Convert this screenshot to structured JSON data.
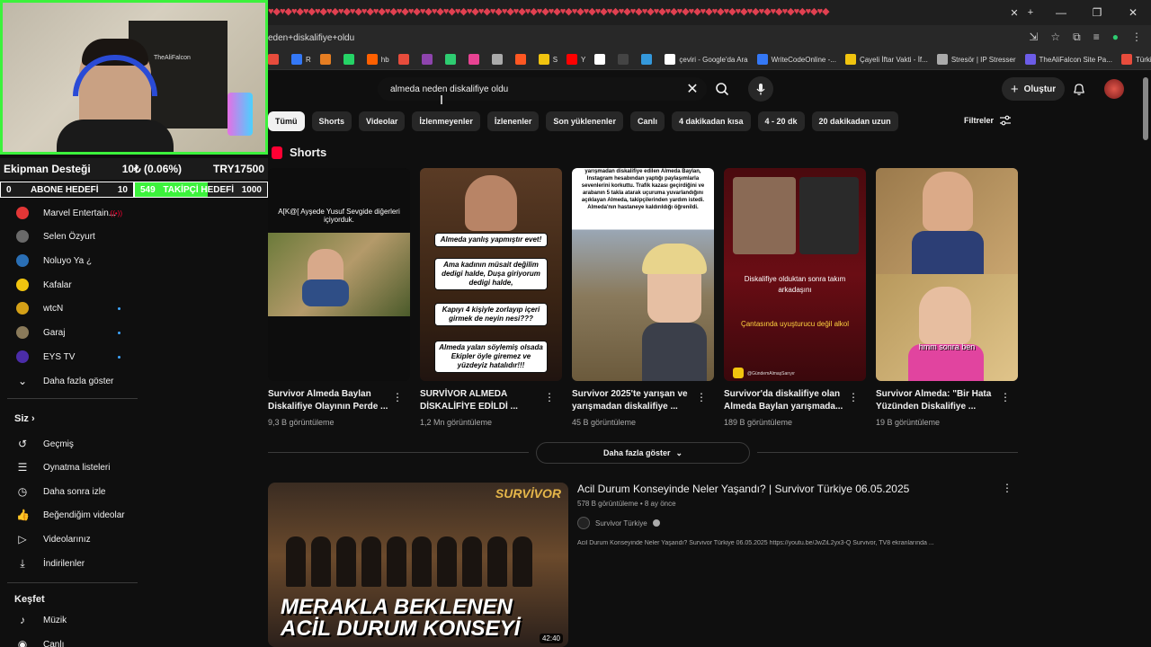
{
  "browser": {
    "url": "eden+diskalifiye+oldu",
    "bookmarks": [
      {
        "label": "",
        "color": "#e74c3c"
      },
      {
        "label": "R",
        "color": "#3478f6"
      },
      {
        "label": "",
        "color": "#e67e22"
      },
      {
        "label": "",
        "color": "#25d366"
      },
      {
        "label": "hb",
        "color": "#ff6000"
      },
      {
        "label": "",
        "color": "#e74c3c"
      },
      {
        "label": "",
        "color": "#8e44ad"
      },
      {
        "label": "",
        "color": "#2ecc71"
      },
      {
        "label": "",
        "color": "#e84393"
      },
      {
        "label": "",
        "color": "#aaa"
      },
      {
        "label": "",
        "color": "#ff5722"
      },
      {
        "label": "S",
        "color": "#f1c40f"
      },
      {
        "label": "Y",
        "color": "#ff0000"
      },
      {
        "label": "",
        "color": "#fff"
      },
      {
        "label": "",
        "color": "#444"
      },
      {
        "label": "",
        "color": "#3498db"
      },
      {
        "label": "çeviri - Google'da Ara",
        "color": "#fff"
      },
      {
        "label": "WriteCodeOnline -...",
        "color": "#3478f6"
      },
      {
        "label": "Çayeli İftar Vakti - İf...",
        "color": "#f1c40f"
      },
      {
        "label": "Stresör | IP Stresser",
        "color": "#aaa"
      },
      {
        "label": "TheAliFalcon Site Pa...",
        "color": "#6c5ce7"
      },
      {
        "label": "Türkiye'nin En Renkl...",
        "color": "#e74c3c"
      }
    ]
  },
  "overlay": {
    "cam_logo": "TheAliFalcon",
    "donation_label": "Ekipman Desteği",
    "donation_amount": "10₺ (0.06%)",
    "donation_goal": "TRY17500",
    "sub_current": "0",
    "sub_label": "ABONE HEDEFİ",
    "sub_target": "10",
    "follow_current": "549",
    "follow_label": "TAKİPÇİ HEDEFİ",
    "follow_target": "1000",
    "follow_progress": 0.549,
    "accent": "#3cf23c"
  },
  "sidebar": {
    "subscriptions": [
      {
        "name": "Marvel Entertain...",
        "color": "#e23636",
        "live": true,
        "dot": false
      },
      {
        "name": "Selen Özyurt",
        "color": "#6a6a6a",
        "live": false,
        "dot": false
      },
      {
        "name": "Noluyo Ya ¿",
        "color": "#2a6fb5",
        "live": false,
        "dot": false
      },
      {
        "name": "Kafalar",
        "color": "#f1c40f",
        "live": false,
        "dot": false
      },
      {
        "name": "wtcN",
        "color": "#d4a017",
        "live": false,
        "dot": true
      },
      {
        "name": "Garaj",
        "color": "#8a7a5a",
        "live": false,
        "dot": true
      },
      {
        "name": "EYS TV",
        "color": "#4b2ca8",
        "live": false,
        "dot": true
      }
    ],
    "show_more": "Daha fazla göster",
    "you_heading": "Siz",
    "you_items": [
      {
        "label": "Geçmiş",
        "icon": "history-icon"
      },
      {
        "label": "Oynatma listeleri",
        "icon": "playlist-icon"
      },
      {
        "label": "Daha sonra izle",
        "icon": "clock-icon"
      },
      {
        "label": "Beğendiğim videolar",
        "icon": "thumbs-up-icon"
      },
      {
        "label": "Videolarınız",
        "icon": "video-icon"
      },
      {
        "label": "İndirilenler",
        "icon": "download-icon"
      }
    ],
    "explore_heading": "Keşfet",
    "explore_items": [
      {
        "label": "Müzik",
        "icon": "music-icon"
      },
      {
        "label": "Canlı",
        "icon": "live-icon"
      }
    ]
  },
  "search": {
    "query": "almeda neden diskalifiye oldu"
  },
  "header": {
    "create_label": "Oluştur"
  },
  "chips": [
    "Tümü",
    "Shorts",
    "Videolar",
    "İzlenmeyenler",
    "İzlenenler",
    "Son yüklenenler",
    "Canlı",
    "4 dakikadan kısa",
    "4 - 20 dk",
    "20 dakikadan uzun"
  ],
  "filters_label": "Filtreler",
  "shorts": {
    "heading": "Shorts",
    "items": [
      {
        "title": "Survivor Almeda Baylan Diskalifiye Olayının Perde ...",
        "views": "9,3 B görüntüleme",
        "caption": "A[K@[ Ayşede Yusuf Sevgide diğerleri içiyorduk."
      },
      {
        "title": "SURVİVOR ALMEDA DİSKALİFİYE EDİLDİ ...",
        "views": "1,2 Mn görüntüleme",
        "boxes": [
          "Almeda yanlış yapmıştır evet!",
          "Ama kadının müsait değilim dedigi halde, Duşa giriyorum dedigi halde,",
          "Kapıyı 4 kişiyle zorlayıp içeri girmek de neyin nesi???",
          "Almeda yalan söylemiş olsada Ekipler öyle giremez ve yüzdeyiz hatalıdır!!!"
        ]
      },
      {
        "title": "Survivor 2025'te yarışan ve yarışmadan diskalifiye ...",
        "views": "45 B görüntüleme",
        "caption": "yarışmadan diskalifiye edilen Almeda Baylan, Instagram hesabından yaptığı paylaşımlarla sevenlerini korkuttu. Trafik kazası geçirdiğini ve arabanın 5 takla atarak uçuruma yuvarlandığını açıklayan Almeda, takipçilerinden yardım istedi. Almeda'nın hastaneye kaldırıldığı öğrenildi."
      },
      {
        "title": "Survivor'da diskalifiye olan Almeda Baylan yarışmada...",
        "views": "189 B görüntüleme",
        "caption": "Diskalifiye olduktan sonra takım arkadaşını",
        "caption2": "Çantasında uyuşturucu değil alkol",
        "handle": "@GündemAlmaşSarıyır"
      },
      {
        "title": "Survivor Almeda: \"Bir Hata Yüzünden Diskalifiye ...",
        "views": "19 B görüntüleme",
        "caption": "hmm sonra ben"
      }
    ]
  },
  "more_button": "Daha fazla göster",
  "video": {
    "title": "Acil Durum Konseyinde Neler Yaşandı? | Survivor Türkiye 06.05.2025",
    "meta": "578 B görüntüleme • 8 ay önce",
    "channel": "Survivor Türkiye",
    "description": "Acil Durum Konseyinde Neler Yaşandı? Survivor Türkiye 06.05.2025 https://youtu.be/JwZiL2yx3-Q Survivor, TV8 ekranlarında ...",
    "thumb_line1": "MERAKLA BEKLENEN",
    "thumb_line2": "ACİL DURUM KONSEYİ",
    "thumb_logo": "SURVİVOR",
    "duration": "42:40"
  }
}
